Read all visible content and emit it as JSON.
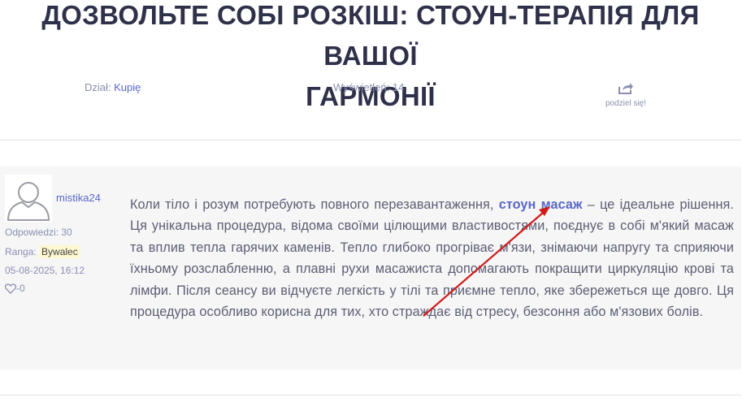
{
  "title": {
    "line1": "ДОЗВОЛЬТЕ СОБІ РОЗКІШ: СТОУН-ТЕРАПІЯ ДЛЯ ВАШОЇ",
    "line2": "ГАРМОНІЇ"
  },
  "meta": {
    "section_label": "Dział:",
    "section_value": "Kupię",
    "views": "Wyświetleń: 14",
    "share_label": "podziel się!"
  },
  "post": {
    "username": "mistika24",
    "replies": "Odpowiedzi: 30",
    "rank_label": "Ranga:",
    "rank_value": "Bywalec",
    "date": "05-08-2025, 16:12",
    "likes": "-0",
    "text_before": "Коли тіло і розум потребують повного перезавантаження, ",
    "keyword": "стоун масаж",
    "text_after": " – це ідеальне рішення. Ця унікальна процедура, відома своїми цілющими властивостями, поєднує в собі м'який масаж та вплив тепла гарячих каменів. Тепло глибоко прогріває м'язи, знімаючи напругу та сприяючи їхньому розслабленню, а плавні рухи масажиста допомагають покращити циркуляцію крові та лімфи. Після сеансу ви відчуєте легкість у тілі та приємне тепло, яке збережеться ще довго. Ця процедура особливо корисна для тих, хто страждає від стресу, безсоння або м'язових болів."
  },
  "colors": {
    "title": "#2e3149",
    "link": "#5a67c9",
    "muted": "#8a8fb0",
    "post_bg": "#f6f6f7",
    "arrow": "#d11a1a"
  }
}
